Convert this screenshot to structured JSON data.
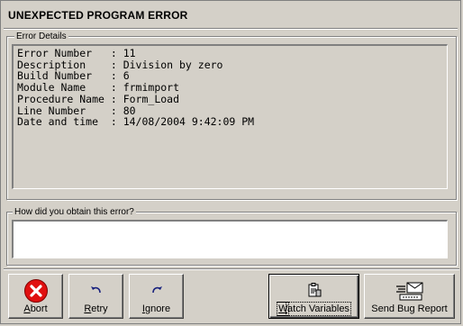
{
  "window": {
    "title": "UNEXPECTED PROGRAM ERROR"
  },
  "details": {
    "legend": "Error Details",
    "lines": [
      "Error Number   : 11",
      "Description    : Division by zero",
      "Build Number   : 6",
      "Module Name    : frmimport",
      "Procedure Name : Form_Load",
      "Line Number    : 80",
      "Date and time  : 14/08/2004 9:42:09 PM"
    ]
  },
  "how": {
    "legend": "How did you obtain this error?",
    "value": ""
  },
  "buttons": {
    "abort": {
      "key": "A",
      "rest": "bort",
      "icon": "error-x-icon"
    },
    "retry": {
      "key": "R",
      "rest": "etry",
      "icon": "undo-arrow-icon"
    },
    "ignore": {
      "key": "I",
      "rest": "gnore",
      "icon": "redo-arrow-icon"
    },
    "watch": {
      "key": "W",
      "rest": "atch Variables",
      "icon": "clipboard-icon"
    },
    "send": {
      "text": "Send Bug Report",
      "icon": "keyboard-envelope-icon"
    }
  }
}
